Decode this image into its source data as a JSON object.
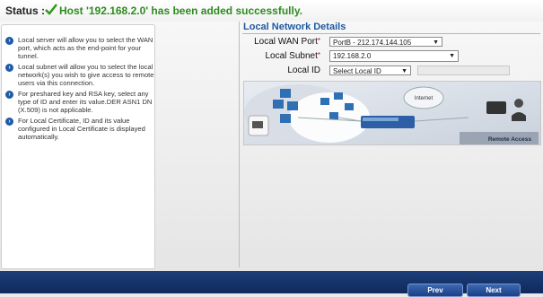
{
  "status": {
    "label": "Status :",
    "message": "Host '192.168.2.0' has been added successfully.",
    "color": "#2e8b1f"
  },
  "help": {
    "items": [
      "Local server will allow you to select the WAN port, which acts as the end-point for your tunnel.",
      "Local subnet will allow you to select the local network(s) you wish to give access to remote users via this connection.",
      "For preshared key and RSA key, select any type of ID and enter its value.DER ASN1 DN (X.509) is not applicable.",
      "For Local Certificate, ID and its value configured in Local Certificate is displayed automatically."
    ]
  },
  "section": {
    "title": "Local Network Details"
  },
  "form": {
    "wan_port": {
      "label": "Local WAN Port",
      "value": "PortB - 212.174.144.105"
    },
    "subnet": {
      "label": "Local Subnet",
      "value": "192.168.2.0"
    },
    "local_id": {
      "label": "Local ID",
      "value": "Select Local ID"
    }
  },
  "diagram": {
    "internet_label": "Internet",
    "remote_label": "Remote Access"
  },
  "buttons": {
    "prev": "Prev",
    "next": "Next"
  },
  "colors": {
    "accent": "#1f5aa0",
    "footer": "#16346c",
    "required": "#dd0000"
  }
}
